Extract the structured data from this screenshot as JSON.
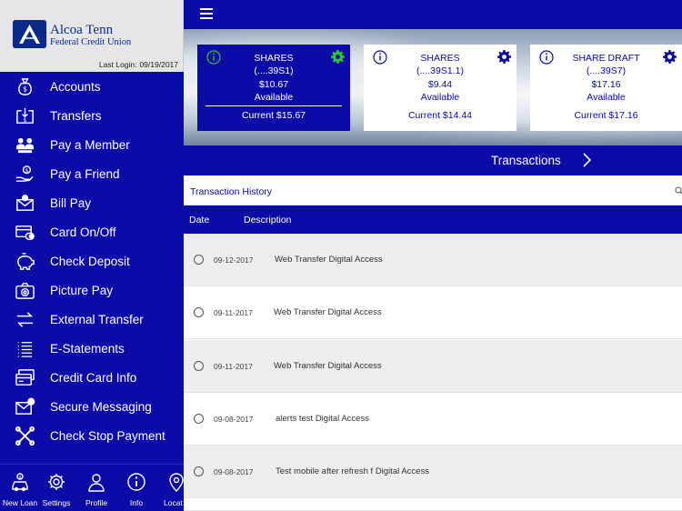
{
  "brand": {
    "name": "Alcoa Tenn",
    "subtitle": "Federal Credit Union",
    "last_login_label": "Last Login:",
    "last_login_date": "09/19/2017"
  },
  "sidebar": {
    "items": [
      {
        "label": "Accounts",
        "icon": "money-bag-icon"
      },
      {
        "label": "Transfers",
        "icon": "transfer-doc-icon"
      },
      {
        "label": "Pay a Member",
        "icon": "members-icon"
      },
      {
        "label": "Pay a Friend",
        "icon": "pay-friend-icon"
      },
      {
        "label": "Bill Pay",
        "icon": "bill-envelope-icon"
      },
      {
        "label": "Card On/Off",
        "icon": "card-toggle-icon"
      },
      {
        "label": "Check Deposit",
        "icon": "piggy-bank-icon"
      },
      {
        "label": "Picture Pay",
        "icon": "camera-icon"
      },
      {
        "label": "External Transfer",
        "icon": "external-arrows-icon"
      },
      {
        "label": "E-Statements",
        "icon": "list-icon"
      },
      {
        "label": "Credit Card Info",
        "icon": "credit-card-icon"
      },
      {
        "label": "Secure Messaging",
        "icon": "secure-message-icon"
      },
      {
        "label": "Check Stop Payment",
        "icon": "stop-x-icon"
      }
    ]
  },
  "bottom_nav": {
    "items": [
      {
        "label": "New Loan",
        "icon": "car-loan-icon"
      },
      {
        "label": "Settings",
        "icon": "gear-icon"
      },
      {
        "label": "Profile",
        "icon": "person-icon"
      },
      {
        "label": "Info",
        "icon": "info-icon"
      },
      {
        "label": "Locat",
        "icon": "location-pin-icon"
      }
    ]
  },
  "accounts": [
    {
      "type": "SHARES",
      "number": "(....39S1)",
      "balance": "$10.67",
      "available_label": "Available",
      "current": "Current $15.67",
      "selected": true
    },
    {
      "type": "SHARES",
      "number": "(....39S1.1)",
      "balance": "$9.44",
      "available_label": "Available",
      "current": "Current $14.44",
      "selected": false
    },
    {
      "type": "SHARE DRAFT",
      "number": "(....39S7)",
      "balance": "$17.16",
      "available_label": "Available",
      "current": "Current $17.16",
      "selected": false
    }
  ],
  "transactions_bar": {
    "label": "Transactions"
  },
  "history": {
    "title": "Transaction History",
    "columns": {
      "date": "Date",
      "description": "Description"
    },
    "rows": [
      {
        "date": "09-12-2017",
        "description": "Web Transfer Digital Access"
      },
      {
        "date": "09-11-2017",
        "description": "Web Transfer Digital Access"
      },
      {
        "date": "09-11-2017",
        "description": "Web Transfer Digital Access"
      },
      {
        "date": "09-08-2017",
        "description": "alerts test Digital Access"
      },
      {
        "date": "09-08-2017",
        "description": "Test mobile after refresh f Digital Access"
      }
    ]
  },
  "colors": {
    "primary": "#0b0ba8",
    "gear_accent": "#2fc32f",
    "row_alt": "#ededed"
  }
}
